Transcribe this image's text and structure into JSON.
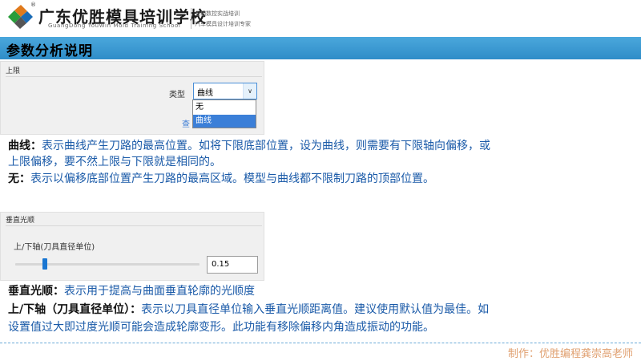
{
  "header": {
    "school_name": "广东优胜模具培训学校",
    "registered_mark": "®",
    "school_name_en": "GuangDong YouWin Mold Training School",
    "slogan_line1": "五轴数控实战培训",
    "slogan_line2": "汽车模具设计培训专家"
  },
  "title": "参数分析说明",
  "panel_limit": {
    "legend": "上限",
    "type_label": "类型",
    "selected_value": "曲线",
    "options": [
      "无",
      "曲线"
    ],
    "partial_link": "查"
  },
  "descriptions": {
    "curve_key": "曲线：",
    "curve_text": "表示曲线产生刀路的最高位置。如将下限底部位置，设为曲线，则需要有下限轴向偏移，或",
    "curve_text_line2": "上限偏移，要不然上限与下限就是相同的。",
    "none_key": "无：",
    "none_text": "表示以偏移底部位置产生刀路的最高区域。模型与曲线都不限制刀路的顶部位置。"
  },
  "panel_smooth": {
    "legend": "垂直光顺",
    "axis_label": "上/下轴(刀具直径单位)",
    "value": "0.15",
    "slider_fraction": 0.15
  },
  "descriptions2": {
    "smooth_key": "垂直光顺：",
    "smooth_text": "表示用于提高与曲面垂直轮廓的光顺度",
    "axis_key": "上/下轴（刀具直径单位）：",
    "axis_text": "表示以刀具直径单位输入垂直光顺距离值。建议使用默认值为最佳。如",
    "axis_text_line2": "设置值过大即过度光顺可能会造成轮廓变形。此功能有移除偏移内角造成振动的功能。"
  },
  "footer": {
    "credit": "制作：优胜编程龚崇高老师"
  },
  "colors": {
    "title_bar": "#3a9bd5",
    "description_text": "#1a5aa8",
    "credit_text": "#e0a070",
    "selection": "#3b7fd8"
  }
}
